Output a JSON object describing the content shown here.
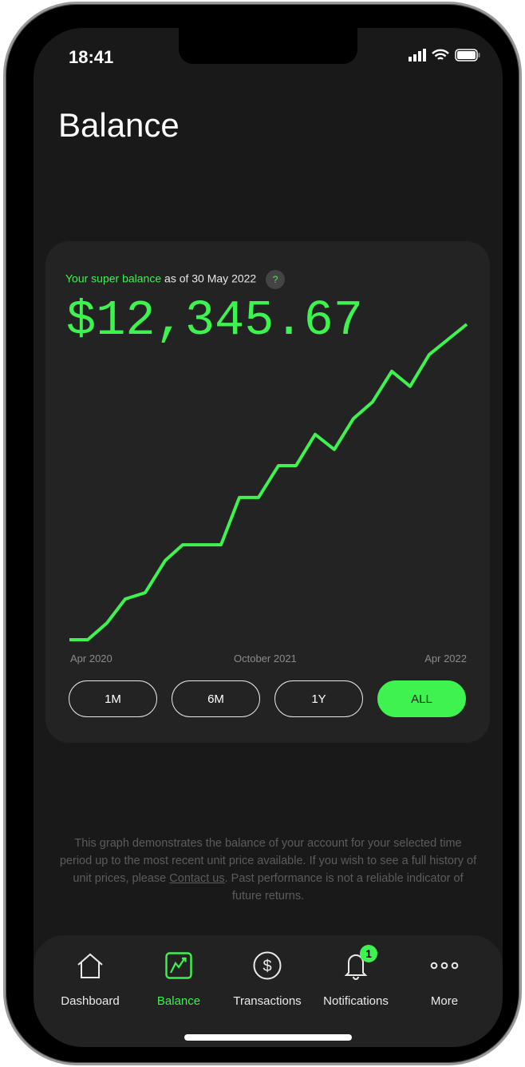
{
  "status_bar": {
    "time": "18:41"
  },
  "page": {
    "title": "Balance"
  },
  "card": {
    "subtitle_highlight": "Your super balance",
    "subtitle_rest": "as of 30 May 2022",
    "help_label": "?",
    "amount": "$12,345.67",
    "colors": {
      "accent": "#3ef24f",
      "card": "#232323"
    }
  },
  "chart_data": {
    "type": "line",
    "x_tick_labels": [
      "Apr 2020",
      "October 2021",
      "Apr 2022"
    ],
    "values_relative": [
      0,
      0,
      5.3,
      12.9,
      14.9,
      25.1,
      30.1,
      30.1,
      45.1,
      45.1,
      55.2,
      55.2,
      65.1,
      60.3,
      70.1,
      75.4,
      85.1,
      80.3,
      90.4,
      100
    ],
    "ylim": [
      0,
      100
    ],
    "grid": false,
    "color": "#3ef24f"
  },
  "ranges": [
    {
      "label": "1M",
      "active": false
    },
    {
      "label": "6M",
      "active": false
    },
    {
      "label": "1Y",
      "active": false
    },
    {
      "label": "ALL",
      "active": true
    }
  ],
  "disclaimer": {
    "before": "This graph demonstrates the balance of your account for your selected time period up to the most recent unit price available. If you wish to see a full history of unit prices, please ",
    "link": "Contact us",
    "after": ". Past performance is not a reliable indicator of future returns."
  },
  "tabs": [
    {
      "label": "Dashboard",
      "icon": "home-icon"
    },
    {
      "label": "Balance",
      "icon": "chart-up-icon",
      "active": true
    },
    {
      "label": "Transactions",
      "icon": "dollar-circle-icon"
    },
    {
      "label": "Notifications",
      "icon": "bell-icon",
      "badge": "1"
    },
    {
      "label": "More",
      "icon": "more-icon"
    }
  ]
}
